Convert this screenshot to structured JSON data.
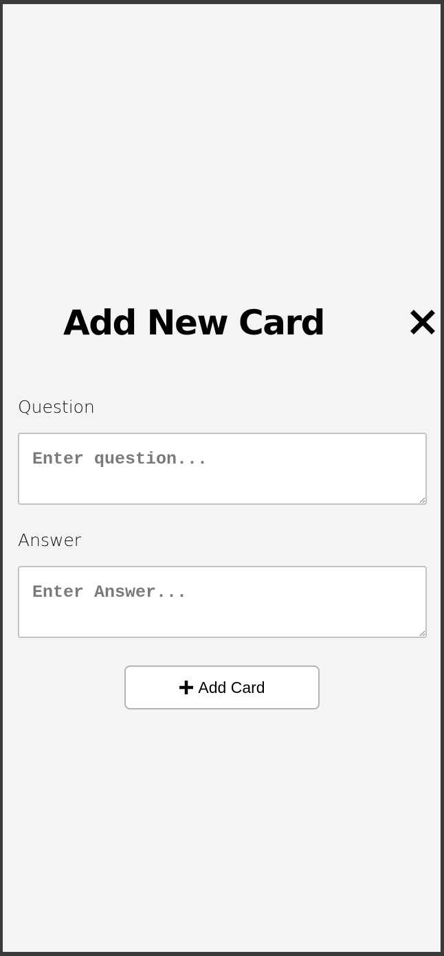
{
  "modal": {
    "title": "Add New Card",
    "close_icon": "close-icon"
  },
  "form": {
    "question_label": "Question",
    "question_placeholder": "Enter question...",
    "question_value": "",
    "answer_label": "Answer",
    "answer_placeholder": "Enter Answer...",
    "answer_value": "",
    "submit_label": "Add Card",
    "submit_icon": "plus-icon"
  },
  "colors": {
    "background": "#f4f4f4",
    "frame": "#3a3a3a",
    "border": "#c2c2c2",
    "placeholder": "#7a7a7a"
  }
}
